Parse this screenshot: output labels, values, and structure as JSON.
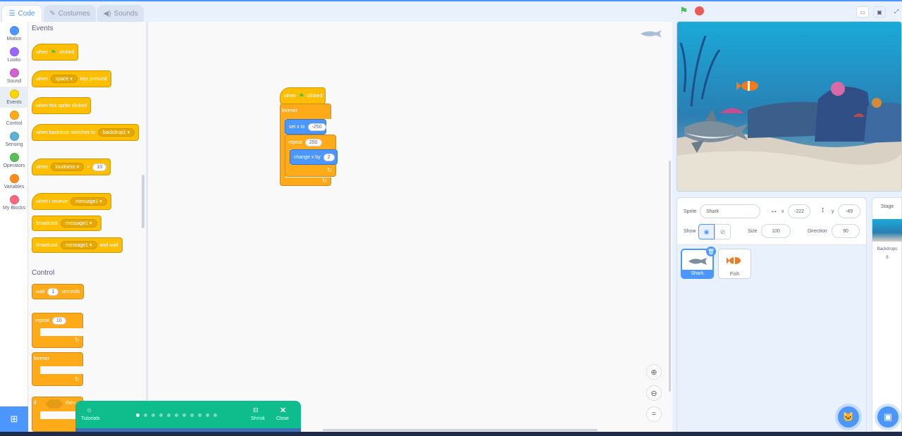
{
  "tabs": [
    {
      "label": "Code",
      "icon": "code-icon"
    },
    {
      "label": "Costumes",
      "icon": "brush-icon"
    },
    {
      "label": "Sounds",
      "icon": "speaker-icon"
    }
  ],
  "categories": [
    {
      "label": "Motion",
      "color": "#4c97ff"
    },
    {
      "label": "Looks",
      "color": "#9966ff"
    },
    {
      "label": "Sound",
      "color": "#cf63cf"
    },
    {
      "label": "Events",
      "color": "#ffd500"
    },
    {
      "label": "Control",
      "color": "#ffab19"
    },
    {
      "label": "Sensing",
      "color": "#5cb1d6"
    },
    {
      "label": "Operators",
      "color": "#59c059"
    },
    {
      "label": "Variables",
      "color": "#ff8c1a"
    },
    {
      "label": "My Blocks",
      "color": "#ff6680"
    }
  ],
  "palette": {
    "events_title": "Events",
    "when_flag": {
      "pre": "when",
      "post": "clicked"
    },
    "when_key": {
      "pre": "when",
      "key": "space",
      "post": "key pressed"
    },
    "when_sprite": "when this sprite clicked",
    "when_backdrop": {
      "pre": "when backdrop switches to",
      "value": "backdrop1"
    },
    "when_loudness": {
      "pre": "when",
      "sensor": "loudness",
      "op": ">",
      "value": "10"
    },
    "when_receive": {
      "pre": "when I receive",
      "value": "message1"
    },
    "broadcast": {
      "pre": "broadcast",
      "value": "message1"
    },
    "broadcast_wait": {
      "pre": "broadcast",
      "value": "message1",
      "post": "and wait"
    },
    "control_title": "Control",
    "wait": {
      "pre": "wait",
      "value": "1",
      "post": "seconds"
    },
    "repeat": {
      "pre": "repeat",
      "value": "10"
    },
    "forever": "forever",
    "if_then": {
      "pre": "if",
      "post": "then"
    }
  },
  "script": {
    "hat": {
      "pre": "when",
      "post": "clicked"
    },
    "forever": "forever",
    "set_x": {
      "pre": "set x to",
      "value": "-250"
    },
    "repeat": {
      "pre": "repeat",
      "value": "250"
    },
    "change_x": {
      "pre": "change x by",
      "value": "2"
    }
  },
  "sprite_info": {
    "sprite_label": "Sprite",
    "sprite_name": "Shark",
    "x_label": "x",
    "x_value": "-222",
    "y_label": "y",
    "y_value": "-49",
    "show_label": "Show",
    "size_label": "Size",
    "size_value": "100",
    "direction_label": "Direction",
    "direction_value": "90"
  },
  "sprites": [
    {
      "name": "Shark",
      "selected": true
    },
    {
      "name": "Fish",
      "selected": false
    }
  ],
  "stage_pane": {
    "title": "Stage",
    "backdrops_label": "Backdrops",
    "backdrops_count": "5"
  },
  "tutorial": {
    "label": "Tutorials",
    "shrink": "Shrink",
    "close": "Close",
    "total_steps": 11,
    "current_step": 1
  }
}
